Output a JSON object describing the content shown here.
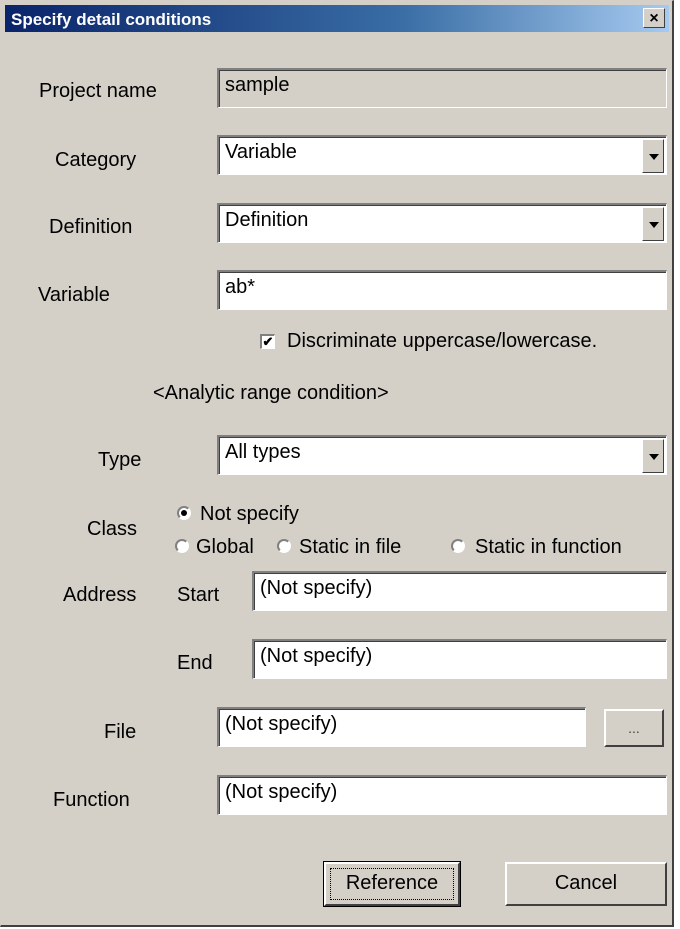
{
  "dialog": {
    "title": "Specify detail conditions",
    "close_glyph": "×"
  },
  "labels": {
    "project_name": "Project name",
    "category": "Category",
    "definition": "Definition",
    "variable": "Variable",
    "analytic_range": "<Analytic range condition>",
    "type": "Type",
    "class": "Class",
    "address": "Address",
    "start": "Start",
    "end": "End",
    "file": "File",
    "function": "Function"
  },
  "fields": {
    "project_name": "sample",
    "category": "Variable",
    "definition": "Definition",
    "variable": "ab*",
    "type": "All types",
    "address_start": "(Not specify)",
    "address_end": "(Not specify)",
    "file": "(Not specify)",
    "function": "(Not specify)"
  },
  "options": {
    "case_sensitive_label": "Discriminate uppercase/lowercase.",
    "case_sensitive_checked": true
  },
  "class_radios": {
    "not_specify": "Not specify",
    "global": "Global",
    "static_in_file": "Static in file",
    "static_in_function": "Static in function",
    "selected": "not_specify"
  },
  "buttons": {
    "browse": "...",
    "reference": "Reference",
    "cancel": "Cancel"
  },
  "icons": {
    "close": "close-icon",
    "dropdown": "chevron-down-icon",
    "check": "checkmark-icon"
  }
}
